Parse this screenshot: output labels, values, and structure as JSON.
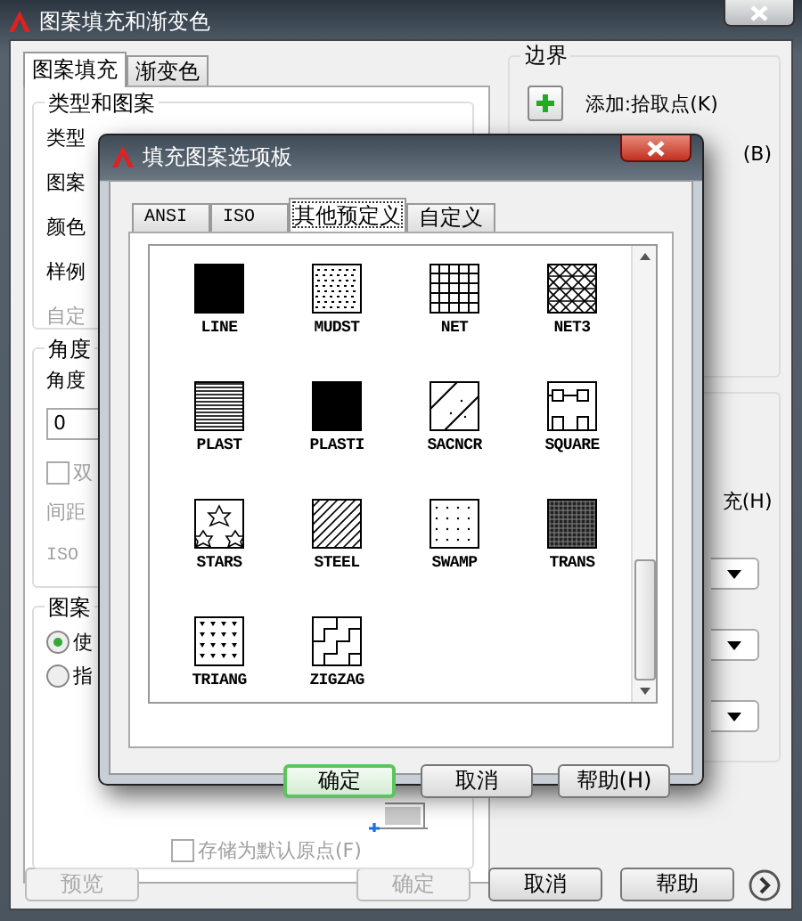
{
  "window": {
    "title": "图案填充和渐变色"
  },
  "tabs": [
    {
      "label": "图案填充",
      "selected": true
    },
    {
      "label": "渐变色",
      "selected": false
    }
  ],
  "type_group": {
    "title": "类型和图案",
    "labels": [
      {
        "text": "类型",
        "disabled": false
      },
      {
        "text": "图案",
        "disabled": false
      },
      {
        "text": "颜色",
        "disabled": false
      },
      {
        "text": "样例",
        "disabled": false
      },
      {
        "text": "自定",
        "disabled": true
      }
    ]
  },
  "angle_group": {
    "title": "角度",
    "angle_label": "角度",
    "angle_value": "0",
    "double": {
      "label": "双",
      "checked": false
    },
    "spacing_label": "间距",
    "iso_label": "ISO"
  },
  "origin_group": {
    "title": "图案",
    "options": [
      {
        "label": "使",
        "selected": true
      },
      {
        "label": "指",
        "selected": false
      }
    ],
    "store_default": {
      "label": "存储为默认原点(F)",
      "checked": false
    }
  },
  "boundary": {
    "title": "边界",
    "add_pick": "添加:拾取点(K)",
    "add_select": "(B)"
  },
  "options_fragment": "充(H)",
  "buttons": [
    {
      "label": "预览",
      "disabled": true
    },
    {
      "label": "确定",
      "disabled": true
    },
    {
      "label": "取消",
      "disabled": false
    },
    {
      "label": "帮助",
      "disabled": false
    }
  ],
  "palette": {
    "title": "填充图案选项板",
    "tabs": [
      {
        "label": "ANSI",
        "selected": false
      },
      {
        "label": "ISO",
        "selected": false
      },
      {
        "label": "其他预定义",
        "selected": true
      },
      {
        "label": "自定义",
        "selected": false
      }
    ],
    "patterns": [
      {
        "name": "LINE",
        "kind": "solid"
      },
      {
        "name": "MUDST",
        "kind": "dashes"
      },
      {
        "name": "NET",
        "kind": "grid"
      },
      {
        "name": "NET3",
        "kind": "triangles"
      },
      {
        "name": "PLAST",
        "kind": "hlines"
      },
      {
        "name": "PLASTI",
        "kind": "solid"
      },
      {
        "name": "SACNCR",
        "kind": "diagonal-dots"
      },
      {
        "name": "SQUARE",
        "kind": "squares"
      },
      {
        "name": "STARS",
        "kind": "stars"
      },
      {
        "name": "STEEL",
        "kind": "diagonal"
      },
      {
        "name": "SWAMP",
        "kind": "dots"
      },
      {
        "name": "TRANS",
        "kind": "crosshatch"
      },
      {
        "name": "TRIANG",
        "kind": "triang"
      },
      {
        "name": "ZIGZAG",
        "kind": "zigzag"
      }
    ],
    "buttons": [
      {
        "label": "确定",
        "default": true
      },
      {
        "label": "取消",
        "default": false
      },
      {
        "label": "帮助(H)",
        "default": false
      }
    ]
  }
}
